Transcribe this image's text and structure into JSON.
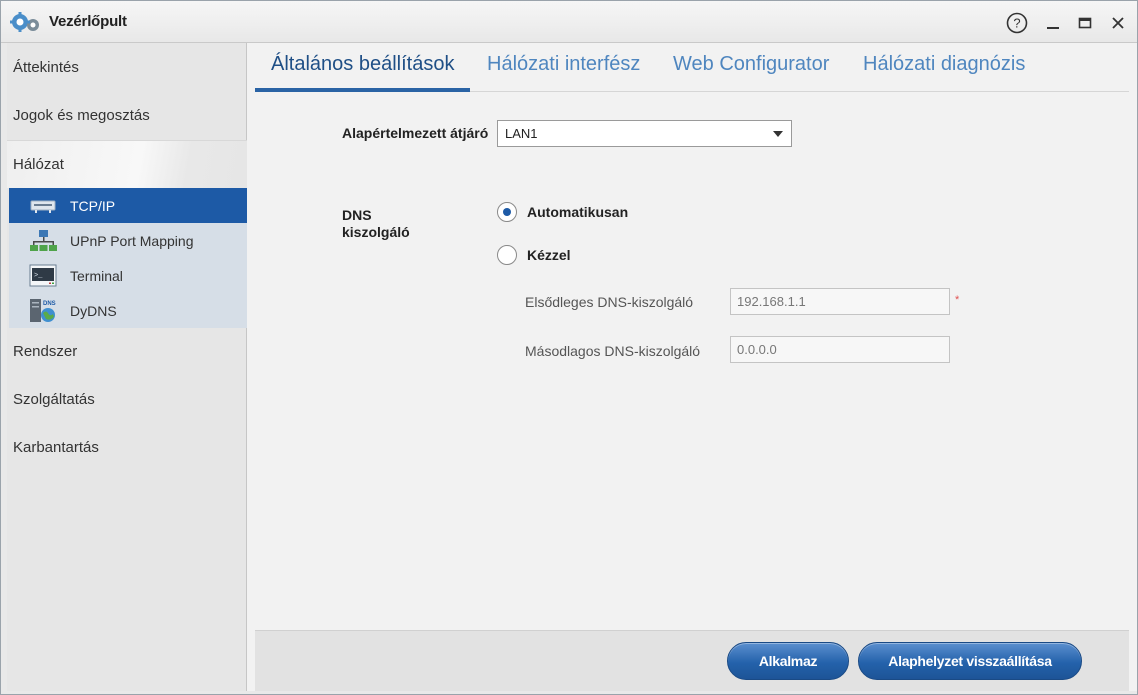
{
  "window": {
    "title": "Vezérlőpult",
    "controls": {
      "help": "?",
      "minimize": "minimize",
      "maximize": "maximize",
      "close": "close"
    }
  },
  "sidebar": {
    "items": [
      {
        "label": "Áttekintés"
      },
      {
        "label": "Jogok és megosztás"
      },
      {
        "label": "Hálózat",
        "expanded": true
      },
      {
        "label": "Rendszer"
      },
      {
        "label": "Szolgáltatás"
      },
      {
        "label": "Karbantartás"
      }
    ],
    "subitems": [
      {
        "label": "TCP/IP",
        "icon": "network-adapter-icon",
        "active": true
      },
      {
        "label": "UPnP Port Mapping",
        "icon": "upnp-network-icon"
      },
      {
        "label": "Terminal",
        "icon": "terminal-icon"
      },
      {
        "label": "DyDNS",
        "icon": "dns-globe-icon"
      }
    ]
  },
  "tabs": [
    {
      "label": "Általános beállítások",
      "active": true
    },
    {
      "label": "Hálózati interfész"
    },
    {
      "label": "Web Configurator"
    },
    {
      "label": "Hálózati diagnózis"
    }
  ],
  "form": {
    "gateway_label": "Alapértelmezett átjáró",
    "gateway_value": "LAN1",
    "dns_label_line1": "DNS",
    "dns_label_line2": "kiszolgáló",
    "dns_auto_label": "Automatikusan",
    "dns_manual_label": "Kézzel",
    "dns_mode": "auto",
    "primary_dns_label": "Elsődleges DNS-kiszolgáló",
    "primary_dns_value": "192.168.1.1",
    "required_mark": "*",
    "secondary_dns_label": "Másodlagos DNS-kiszolgáló",
    "secondary_dns_value": "0.0.0.0"
  },
  "footer": {
    "apply_label": "Alkalmaz",
    "reset_label": "Alaphelyzet visszaállítása"
  },
  "colors": {
    "accent": "#1d5aa6",
    "tab_inactive": "#4f86bf",
    "subnav_bg": "#d6dee7"
  }
}
